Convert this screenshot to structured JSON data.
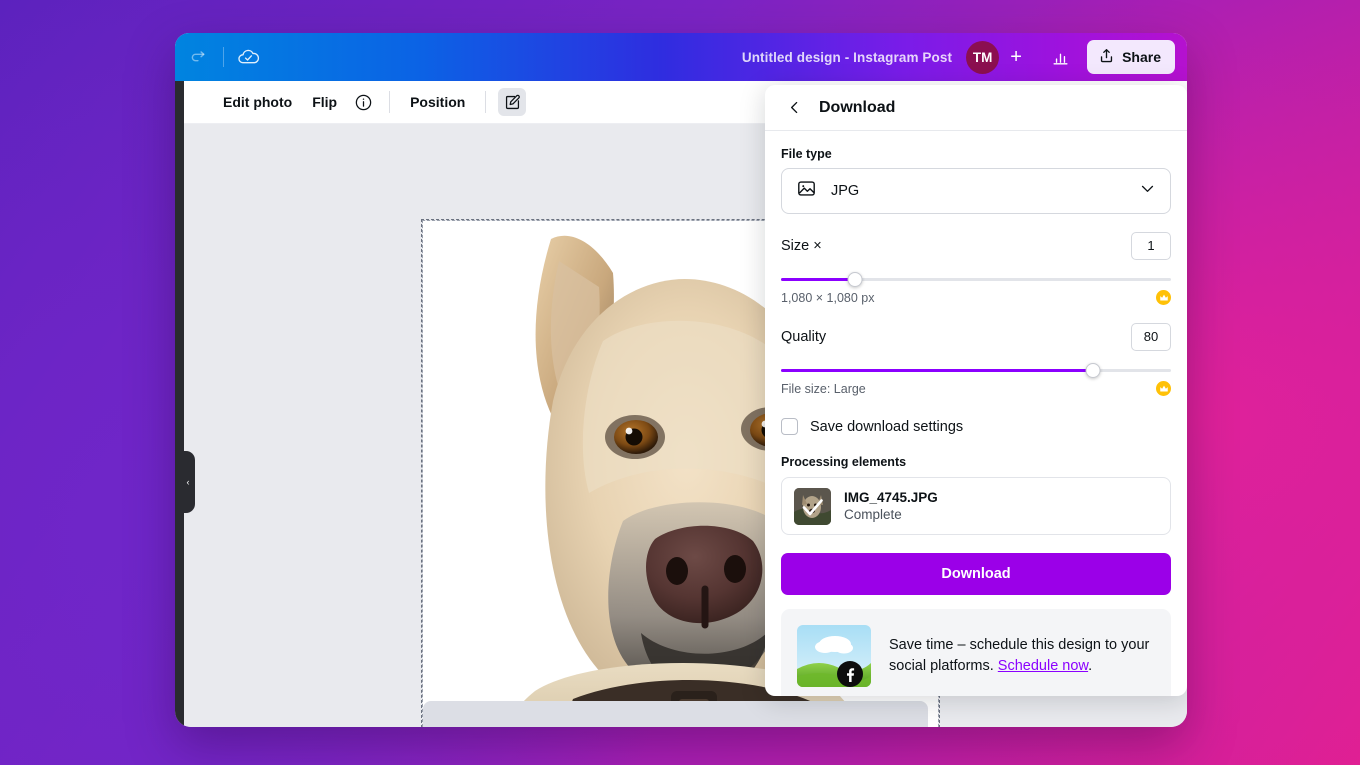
{
  "header": {
    "doc_title": "Untitled design - Instagram Post",
    "avatar_initials": "TM",
    "plus_label": "+",
    "share_label": "Share",
    "icons": {
      "redo": "redo-icon",
      "cloud_saved": "cloud-saved-icon",
      "insights": "bar-chart-icon",
      "share": "share-upload-icon"
    }
  },
  "toolbar": {
    "edit_photo": "Edit photo",
    "flip": "Flip",
    "info_icon": "info-icon",
    "position": "Position",
    "edit_icon": "pencil-square-icon"
  },
  "sidebar": {
    "collapse_chevron": "‹"
  },
  "panel": {
    "title": "Download",
    "back_icon": "chevron-left-icon",
    "file_type": {
      "label": "File type",
      "value": "JPG",
      "icon": "image-icon",
      "chevron": "chevron-down-icon"
    },
    "size": {
      "label": "Size ×",
      "value": "1",
      "dimensions": "1,080 × 1,080 px",
      "slider_percent": 19,
      "crown_icon": "crown-badge-icon"
    },
    "quality": {
      "label": "Quality",
      "value": "80",
      "file_size": "File size: Large",
      "slider_percent": 80,
      "crown_icon": "crown-badge-icon"
    },
    "save_settings": {
      "label": "Save download settings",
      "checked": false
    },
    "processing": {
      "label": "Processing elements",
      "items": [
        {
          "name": "IMG_4745.JPG",
          "status": "Complete"
        }
      ]
    },
    "download_button": "Download",
    "promo": {
      "text_before": "Save time – schedule this design to your social platforms. ",
      "link": "Schedule now",
      "text_after": ".",
      "icon": "facebook-icon"
    }
  },
  "colors": {
    "accent_purple": "#8b00ff",
    "download_button": "#9b00e8",
    "crown_yellow": "#ffc107",
    "avatar_bg": "#8b0f50",
    "share_bg": "#f3e8fd"
  }
}
